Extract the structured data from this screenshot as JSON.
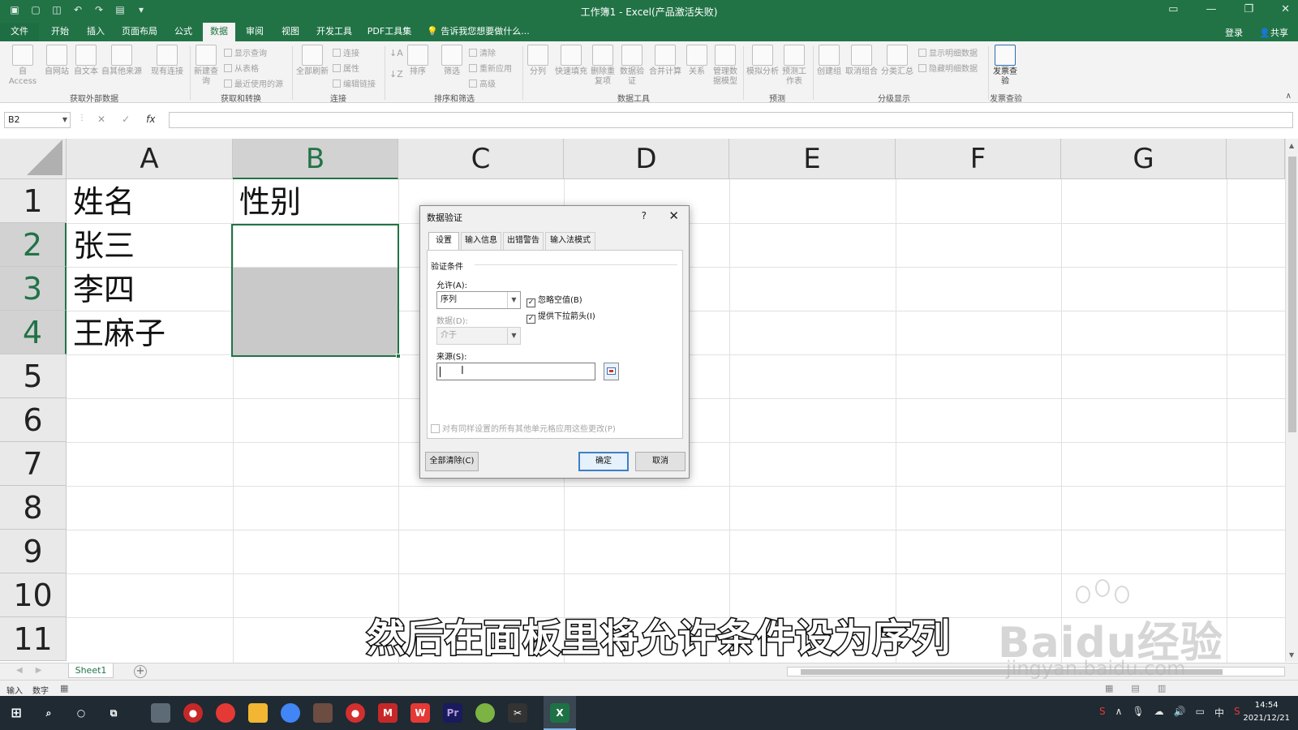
{
  "window": {
    "title": "工作簿1 - Excel(产品激活失败)",
    "login": "登录",
    "share": "共享"
  },
  "ribbon_tabs": [
    "文件",
    "开始",
    "插入",
    "页面布局",
    "公式",
    "数据",
    "审阅",
    "视图",
    "开发工具",
    "PDF工具集"
  ],
  "active_tab": "数据",
  "tell_me": "告诉我您想要做什么...",
  "ribbon": {
    "buttons": [
      "自 Access",
      "自网站",
      "自文本",
      "自其他来源",
      "现有连接",
      "新建查询",
      "全部刷新",
      "排序",
      "筛选",
      "分列",
      "快速填充",
      "删除重复项",
      "数据验证",
      "合并计算",
      "关系",
      "管理数据模型",
      "模拟分析",
      "预测工作表",
      "创建组",
      "取消组合",
      "分类汇总",
      "发票查验"
    ],
    "small_items": [
      "显示查询",
      "从表格",
      "最近使用的源",
      "连接",
      "属性",
      "编辑链接",
      "清除",
      "重新应用",
      "高级",
      "显示明细数据",
      "隐藏明细数据"
    ],
    "groups": [
      "获取外部数据",
      "获取和转换",
      "连接",
      "排序和筛选",
      "数据工具",
      "预测",
      "分级显示",
      "发票查验"
    ]
  },
  "formula_bar": {
    "name_box": "B2",
    "fx": "fx",
    "formula": ""
  },
  "grid": {
    "columns": [
      "A",
      "B",
      "C",
      "D",
      "E",
      "F",
      "G"
    ],
    "rows": [
      "1",
      "2",
      "3",
      "4",
      "5",
      "6",
      "7",
      "8",
      "9",
      "10",
      "11"
    ],
    "cells": {
      "A1": "姓名",
      "B1": "性别",
      "A2": "张三",
      "A3": "李四",
      "A4": "王麻子"
    }
  },
  "dialog": {
    "title": "数据验证",
    "help": "?",
    "close": "✕",
    "tabs": [
      "设置",
      "输入信息",
      "出错警告",
      "输入法模式"
    ],
    "section": "验证条件",
    "allow_label": "允许(A):",
    "allow_value": "序列",
    "data_label": "数据(D):",
    "data_value": "介于",
    "ignore_blank": "忽略空值(B)",
    "dropdown": "提供下拉箭头(I)",
    "source_label": "来源(S):",
    "source_value": "",
    "apply_all": "对有同样设置的所有其他单元格应用这些更改(P)",
    "clear_all": "全部清除(C)",
    "ok": "确定",
    "cancel": "取消"
  },
  "sheet_tab": "Sheet1",
  "status": {
    "mode": "输入",
    "num": "数字"
  },
  "subtitle": "然后在面板里将允许条件设为序列",
  "watermark": {
    "logo": "Baidu经验",
    "url": "jingyan.baidu.com"
  },
  "taskbar": {
    "ime_cn": "中",
    "time": "14:54",
    "date": "2021/12/21"
  },
  "colors": {
    "excel_green": "#217346",
    "taskbar": "#1f2a33"
  }
}
